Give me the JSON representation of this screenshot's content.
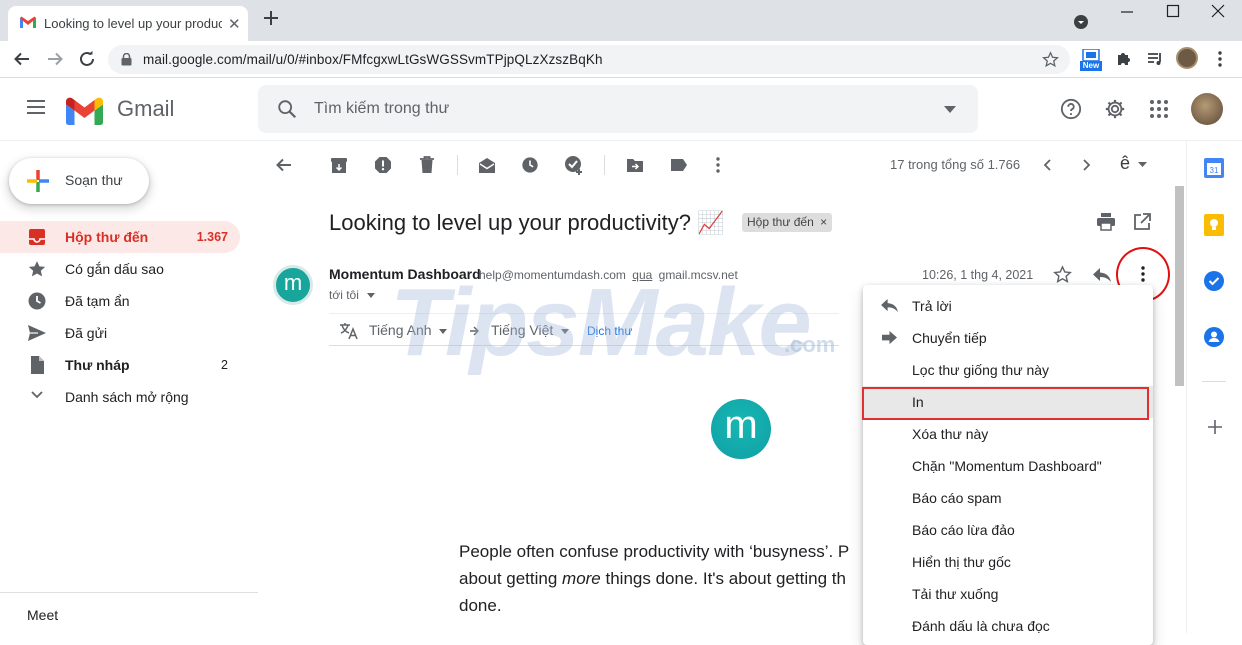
{
  "browser": {
    "tab_title": "Looking to level up your productivity? 📈",
    "url": "mail.google.com/mail/u/0/#inbox/FMfcgxwLtGsWGSSvmTPjpQLzXzszBqKh",
    "extension_badge": "New"
  },
  "gmail": {
    "wordmark": "Gmail",
    "search_placeholder": "Tìm kiếm trong thư",
    "compose_label": "Soạn thư",
    "nav": [
      {
        "label": "Hộp thư đến",
        "count": "1.367"
      },
      {
        "label": "Có gắn dấu sao",
        "count": ""
      },
      {
        "label": "Đã tạm ẩn",
        "count": ""
      },
      {
        "label": "Đã gửi",
        "count": ""
      },
      {
        "label": "Thư nháp",
        "count": "2"
      },
      {
        "label": "Danh sách mở rộng",
        "count": ""
      }
    ],
    "meet_label": "Meet",
    "pager": "17 trong tổng số 1.766",
    "input_tool": "ê"
  },
  "email": {
    "subject": "Looking to level up your productivity? 📈",
    "label": "Hộp thư đến",
    "label_close": "×",
    "sender_name": "Momentum Dashboard",
    "sender_email": "help@momentumdash.com",
    "via_word": "qua",
    "via_domain": "gmail.mcsv.net",
    "to_line": "tới tôi",
    "date": "10:26, 1 thg 4, 2021",
    "avatar_letter": "m",
    "translate_from": "Tiếng Anh",
    "translate_to": "Tiếng Việt",
    "translate_link": "Dịch thư",
    "body_line1": "People often confuse productivity with ‘busyness’. P",
    "body_line2_a": "about getting ",
    "body_line2_em": "more",
    "body_line2_b": " things done. It's about getting th",
    "body_line3": "done."
  },
  "menu": {
    "items": [
      {
        "label": "Trả lời",
        "icon": "reply-icon"
      },
      {
        "label": "Chuyển tiếp",
        "icon": "forward-icon"
      },
      {
        "label": "Lọc thư giống thư này",
        "icon": ""
      },
      {
        "label": "In",
        "icon": ""
      },
      {
        "label": "Xóa thư này",
        "icon": ""
      },
      {
        "label": "Chặn \"Momentum Dashboard\"",
        "icon": ""
      },
      {
        "label": "Báo cáo spam",
        "icon": ""
      },
      {
        "label": "Báo cáo lừa đảo",
        "icon": ""
      },
      {
        "label": "Hiển thị thư gốc",
        "icon": ""
      },
      {
        "label": "Tải thư xuống",
        "icon": ""
      },
      {
        "label": "Đánh dấu là chưa đọc",
        "icon": ""
      }
    ]
  },
  "watermark": {
    "main": "TipsMake",
    "sub": ".com"
  },
  "colors": {
    "accent_red": "#d93025",
    "highlight_red": "#e03030",
    "link_blue": "#1a73e8",
    "avatar_teal": "#17a59c"
  }
}
